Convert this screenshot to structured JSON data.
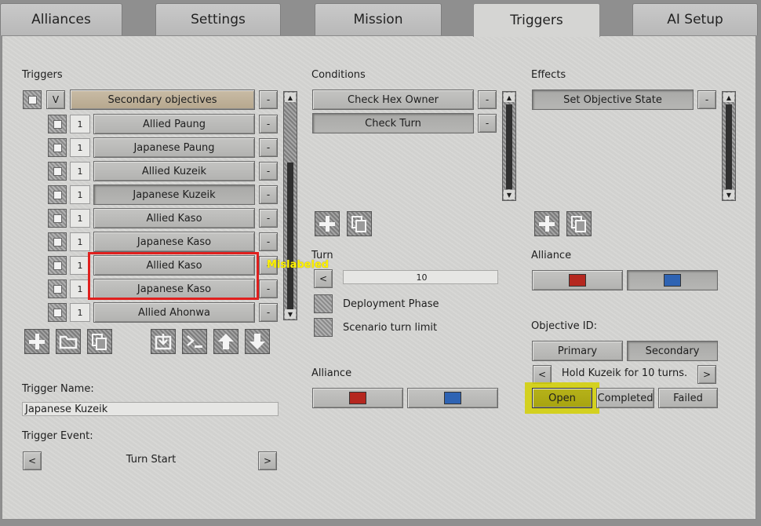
{
  "tabs": [
    "Alliances",
    "Settings",
    "Mission",
    "Triggers",
    "AI Setup"
  ],
  "active_tab": "Triggers",
  "triggers": {
    "section_label": "Triggers",
    "group_toggle": "V",
    "group_label": "Secondary objectives",
    "remove_label": "-",
    "items": [
      {
        "num": "1",
        "label": "Allied Paung"
      },
      {
        "num": "1",
        "label": "Japanese Paung"
      },
      {
        "num": "1",
        "label": "Allied Kuzeik"
      },
      {
        "num": "1",
        "label": "Japanese Kuzeik"
      },
      {
        "num": "1",
        "label": "Allied Kaso"
      },
      {
        "num": "1",
        "label": "Japanese Kaso"
      },
      {
        "num": "1",
        "label": "Allied Kaso"
      },
      {
        "num": "1",
        "label": "Japanese Kaso"
      },
      {
        "num": "1",
        "label": "Allied Ahonwa"
      }
    ],
    "selected_index": 3,
    "annotation": "Mislabeled"
  },
  "trigger_name": {
    "label": "Trigger Name:",
    "value": "Japanese Kuzeik"
  },
  "trigger_event": {
    "label": "Trigger Event:",
    "value": "Turn Start",
    "prev": "<",
    "next": ">"
  },
  "conditions": {
    "section_label": "Conditions",
    "items": [
      "Check Hex Owner",
      "Check Turn"
    ],
    "selected_index": 1
  },
  "turn": {
    "label": "Turn",
    "decrement": "<",
    "value": "10",
    "deployment_phase": "Deployment Phase",
    "scenario_limit": "Scenario turn limit"
  },
  "alliance_left": {
    "label": "Alliance"
  },
  "effects": {
    "section_label": "Effects",
    "items": [
      "Set Objective State"
    ]
  },
  "alliance_right": {
    "label": "Alliance"
  },
  "objective": {
    "id_label": "Objective ID:",
    "types": [
      "Primary",
      "Secondary"
    ],
    "selected_type": "Secondary",
    "prev": "<",
    "next": ">",
    "text": "Hold Kuzeik for 10 turns.",
    "states": [
      "Open",
      "Completed",
      "Failed"
    ],
    "selected_state": "Open"
  },
  "colors": {
    "allied_red": "#b5271f",
    "japanese_blue": "#2e63b3",
    "highlight_red": "#e0201e",
    "highlight_yellow": "#d4d000",
    "annotation_yellow": "#fff200"
  },
  "icons": {
    "list_tools": [
      "plus-icon",
      "folder-icon",
      "copy-icon",
      "save-icon",
      "console-icon",
      "arrow-up-icon",
      "arrow-down-icon"
    ],
    "conditions_tools": [
      "plus-icon",
      "copy-icon"
    ],
    "effects_tools": [
      "plus-icon",
      "copy-icon"
    ]
  }
}
